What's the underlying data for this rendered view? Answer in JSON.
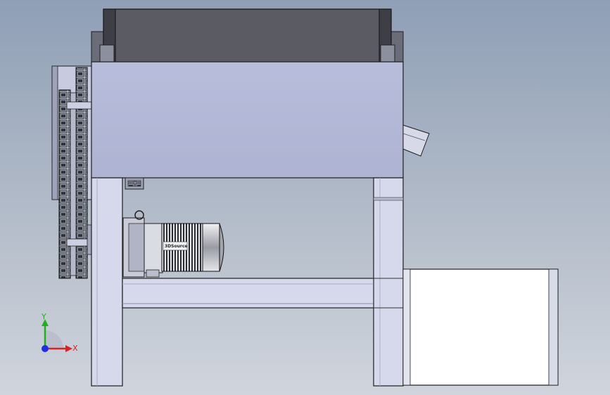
{
  "viewport": {
    "background_top": "#8f9fb6",
    "background_bottom": "#d0d5dd"
  },
  "model": {
    "motor_label": "3DSource",
    "body_color": "#b4b9d8",
    "hopper_color": "#5a5b63",
    "frame_color": "#d6d9eb",
    "outline_color": "#1e1e1e"
  },
  "triad": {
    "x_label": "X",
    "y_label": "Y",
    "x_color": "#e02020",
    "y_color": "#20b020",
    "z_color": "#2030e0"
  }
}
